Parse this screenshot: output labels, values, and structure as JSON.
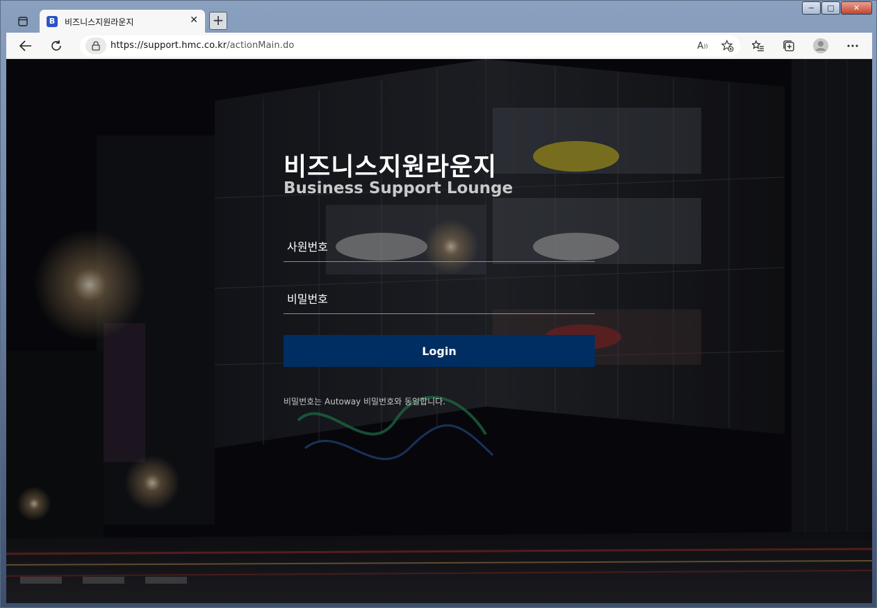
{
  "browser": {
    "tab_title": "비즈니스지원라운지",
    "favicon_letter": "B",
    "new_tab_label": "+",
    "url_host": "https://support.hmc.co.kr",
    "url_path": "/actionMain.do",
    "window_min": "−",
    "window_max": "□",
    "window_close": "✕"
  },
  "login": {
    "title_ko": "비즈니스지원라운지",
    "title_en": "Business Support Lounge",
    "employee_id_placeholder": "사원번호",
    "password_placeholder": "비밀번호",
    "login_label": "Login",
    "notice": "비밀번호는 Autoway 비밀번호와 동일합니다."
  },
  "colors": {
    "login_button": "#002d62",
    "favicon": "#2b54c5"
  }
}
